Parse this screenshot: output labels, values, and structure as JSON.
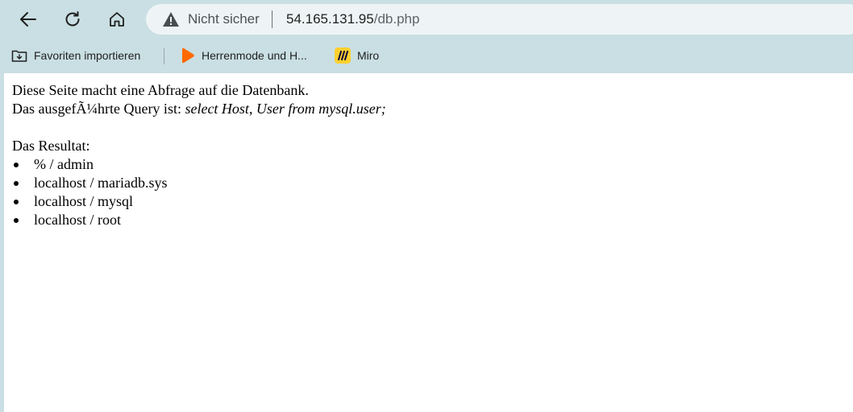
{
  "browser": {
    "security_label": "Nicht sicher",
    "url_host": "54.165.131.95",
    "url_path": "/db.php",
    "bookmarks": [
      {
        "label": "Favoriten importieren",
        "icon": "import-favorites-icon"
      },
      {
        "label": "Herrenmode und H...",
        "icon": "zalando-icon"
      },
      {
        "label": "Miro",
        "icon": "miro-icon"
      }
    ]
  },
  "page": {
    "line1": "Diese Seite macht eine Abfrage auf die Datenbank.",
    "line2_prefix": "Das ausgefÃ¼hrte Query ist: ",
    "query": "select Host, User from mysql.user;",
    "result_heading": "Das Resultat:",
    "results": [
      "% / admin",
      "localhost / mariadb.sys",
      "localhost / mysql",
      "localhost / root"
    ]
  },
  "colors": {
    "chrome_bg": "#c9dfe3",
    "omnibox_bg": "#eef4f5",
    "zalando_orange": "#ff6900",
    "miro_yellow": "#ffd02f"
  }
}
